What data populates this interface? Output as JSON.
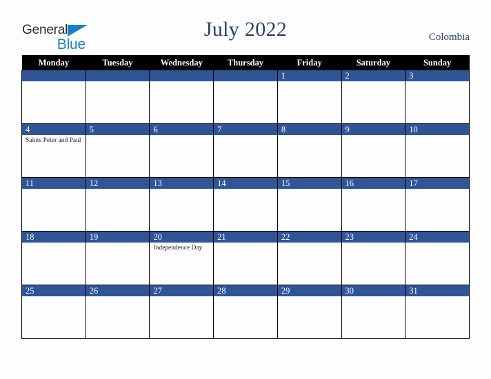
{
  "brand": {
    "name_part1": "General",
    "name_part2": "Blue",
    "triangle_icon": "triangle-icon",
    "primary_color": "#1b7fc4"
  },
  "header": {
    "title": "July 2022",
    "country": "Colombia",
    "title_color": "#2b3f66"
  },
  "colors": {
    "weekday_header_bg": "#000000",
    "weekday_header_text": "#ffffff",
    "day_bar_bg": "#2f5597",
    "day_bar_text": "#ffffff",
    "cell_bg": "#fdfdfd",
    "grid_border": "#000000",
    "page_bg": "#fdfdfd"
  },
  "calendar": {
    "weekdays": [
      "Monday",
      "Tuesday",
      "Wednesday",
      "Thursday",
      "Friday",
      "Saturday",
      "Sunday"
    ],
    "weeks": [
      [
        {
          "day": "",
          "events": ""
        },
        {
          "day": "",
          "events": ""
        },
        {
          "day": "",
          "events": ""
        },
        {
          "day": "",
          "events": ""
        },
        {
          "day": "1",
          "events": ""
        },
        {
          "day": "2",
          "events": ""
        },
        {
          "day": "3",
          "events": ""
        }
      ],
      [
        {
          "day": "4",
          "events": "Saints Peter and Paul"
        },
        {
          "day": "5",
          "events": ""
        },
        {
          "day": "6",
          "events": ""
        },
        {
          "day": "7",
          "events": ""
        },
        {
          "day": "8",
          "events": ""
        },
        {
          "day": "9",
          "events": ""
        },
        {
          "day": "10",
          "events": ""
        }
      ],
      [
        {
          "day": "11",
          "events": ""
        },
        {
          "day": "12",
          "events": ""
        },
        {
          "day": "13",
          "events": ""
        },
        {
          "day": "14",
          "events": ""
        },
        {
          "day": "15",
          "events": ""
        },
        {
          "day": "16",
          "events": ""
        },
        {
          "day": "17",
          "events": ""
        }
      ],
      [
        {
          "day": "18",
          "events": ""
        },
        {
          "day": "19",
          "events": ""
        },
        {
          "day": "20",
          "events": "Independence Day"
        },
        {
          "day": "21",
          "events": ""
        },
        {
          "day": "22",
          "events": ""
        },
        {
          "day": "23",
          "events": ""
        },
        {
          "day": "24",
          "events": ""
        }
      ],
      [
        {
          "day": "25",
          "events": ""
        },
        {
          "day": "26",
          "events": ""
        },
        {
          "day": "27",
          "events": ""
        },
        {
          "day": "28",
          "events": ""
        },
        {
          "day": "29",
          "events": ""
        },
        {
          "day": "30",
          "events": ""
        },
        {
          "day": "31",
          "events": ""
        }
      ]
    ]
  }
}
